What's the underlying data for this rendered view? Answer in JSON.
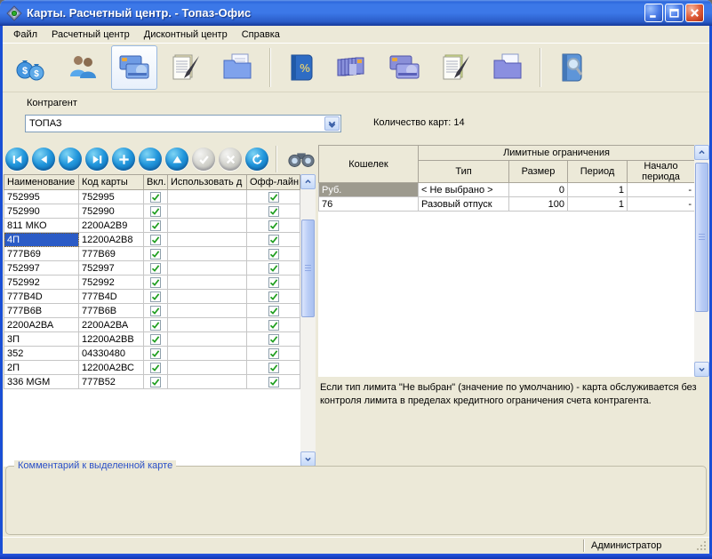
{
  "titlebar": {
    "title": "Карты. Расчетный центр. - Топаз-Офис",
    "icons": [
      "app-diamond-icon",
      "minimize-button",
      "maximize-button",
      "close-button"
    ]
  },
  "menu": {
    "items": [
      "Файл",
      "Расчетный центр",
      "Дисконтный центр",
      "Справка"
    ]
  },
  "toolbar": {
    "active_button": "cards-button",
    "buttons": [
      "money-bags-icon",
      "users-icon",
      "credit-cards-icon",
      "document-pen-icon",
      "folder-documents-icon",
      "percent-book-icon",
      "card-stack-icon",
      "discount-cards-icon",
      "discount-document-pen-icon",
      "discount-folder-icon",
      "book-search-icon"
    ]
  },
  "filter": {
    "label": "Контрагент",
    "value": "ТОПАЗ",
    "count": "Количество карт: 14"
  },
  "nav": {
    "buttons": [
      "first-record",
      "prev-record",
      "next-record",
      "last-record",
      "add-record",
      "delete-record",
      "edit-record",
      "confirm (disabled)",
      "cancel (disabled)",
      "refresh",
      "search-binoculars"
    ]
  },
  "cards_table": {
    "columns": [
      "Наименование",
      "Код карты",
      "Вкл.",
      "Использовать д",
      "Офф-лайн"
    ],
    "selected_index": 3,
    "rows": [
      {
        "name": "752995",
        "code": "752995",
        "enabled": true,
        "use_until": "",
        "offline": true
      },
      {
        "name": "752990",
        "code": "752990",
        "enabled": true,
        "use_until": "",
        "offline": true
      },
      {
        "name": "811 МКО",
        "code": "2200А2В9",
        "enabled": true,
        "use_until": "",
        "offline": true
      },
      {
        "name": "4П",
        "code": "12200А2В8",
        "enabled": true,
        "use_until": "",
        "offline": true
      },
      {
        "name": "777В69",
        "code": "777В69",
        "enabled": true,
        "use_until": "",
        "offline": true
      },
      {
        "name": "752997",
        "code": "752997",
        "enabled": true,
        "use_until": "",
        "offline": true
      },
      {
        "name": "752992",
        "code": "752992",
        "enabled": true,
        "use_until": "",
        "offline": true
      },
      {
        "name": "777В4D",
        "code": "777В4D",
        "enabled": true,
        "use_until": "",
        "offline": true
      },
      {
        "name": "777В6В",
        "code": "777В6В",
        "enabled": true,
        "use_until": "",
        "offline": true
      },
      {
        "name": "2200А2ВА",
        "code": "2200А2ВА",
        "enabled": true,
        "use_until": "",
        "offline": true
      },
      {
        "name": "3П",
        "code": "12200А2ВВ",
        "enabled": true,
        "use_until": "",
        "offline": true
      },
      {
        "name": "352",
        "code": "04330480",
        "enabled": true,
        "use_until": "",
        "offline": true
      },
      {
        "name": "2П",
        "code": "12200А2ВС",
        "enabled": true,
        "use_until": "",
        "offline": true
      },
      {
        "name": "336 MGM",
        "code": "777В52",
        "enabled": true,
        "use_until": "",
        "offline": true
      }
    ]
  },
  "wallet_table": {
    "corner": "Кошелек",
    "group": "Лимитные ограничения",
    "columns": [
      "Тип",
      "Размер",
      "Период",
      "Начало периода"
    ],
    "selected_index": 0,
    "rows": [
      {
        "wallet": "Руб.",
        "type": "< Не выбрано >",
        "size": "0",
        "period": "1",
        "start": "-"
      },
      {
        "wallet": "76",
        "type": "Разовый отпуск",
        "size": "100",
        "period": "1",
        "start": "-"
      }
    ]
  },
  "hint": {
    "text": "Если тип лимита \"Не выбран\" (значение по умолчанию) - карта обслуживается без контроля лимита в пределах кредитного ограничения счета контрагента."
  },
  "comment": {
    "label": "Комментарий к выделенной карте"
  },
  "statusbar": {
    "user": "Администратор"
  },
  "colors": {
    "titlebar_blue": "#3C78E8",
    "window_border": "#1A4FD5",
    "selection_blue": "#2B5BC6",
    "inactive_selection_gray": "#9D9A8E",
    "check_green": "#1E9E1E",
    "background": "#ECE9D8"
  }
}
